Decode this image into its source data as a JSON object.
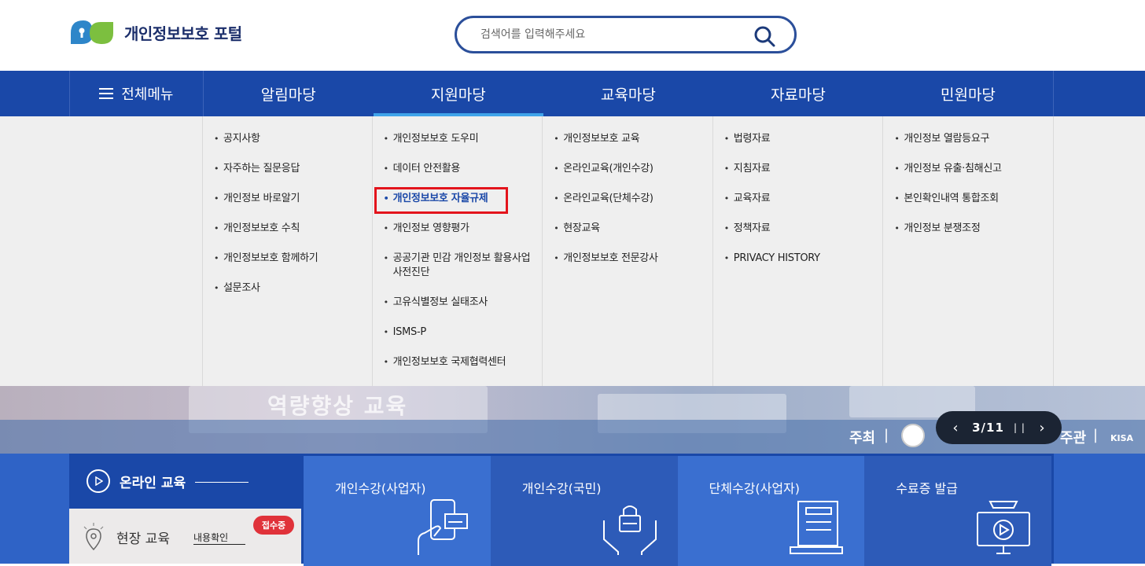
{
  "header": {
    "logo_text": "개인정보보호 포털",
    "search_placeholder": "검색어를 입력해주세요"
  },
  "nav": {
    "all_menu": "전체메뉴",
    "tabs": [
      "알림마당",
      "지원마당",
      "교육마당",
      "자료마당",
      "민원마당"
    ],
    "active_tab": "지원마당"
  },
  "mega_menu": {
    "columns": [
      [
        "공지사항",
        "자주하는 질문응답",
        "개인정보 바로알기",
        "개인정보보호 수칙",
        "개인정보보호 함께하기",
        "설문조사"
      ],
      [
        "개인정보보호 도우미",
        "데이터 안전활용",
        "개인정보보호 자율규제",
        "개인정보 영향평가",
        "공공기관 민감 개인정보 활용사업 사전진단",
        "고유식별정보 실태조사",
        "ISMS-P",
        "개인정보보호 국제협력센터"
      ],
      [
        "개인정보보호 교육",
        "온라인교육(개인수강)",
        "온라인교육(단체수강)",
        "현장교육",
        "개인정보보호 전문강사"
      ],
      [
        "법령자료",
        "지침자료",
        "교육자료",
        "정책자료",
        "PRIVACY HISTORY"
      ],
      [
        "개인정보 열람등요구",
        "개인정보 유출·침해신고",
        "본인확인내역 통합조회",
        "개인정보 분쟁조정"
      ]
    ],
    "highlighted": "개인정보보호 자율규제"
  },
  "hero": {
    "title": "역량향상 교육",
    "host": "주최",
    "organizer": "주관",
    "kisa": "KISA",
    "slider_count": "3/11"
  },
  "education": {
    "online_label": "온라인 교육",
    "field_label": "현장 교육",
    "field_check": "내용확인",
    "field_badge": "접수중",
    "cards": [
      "개인수강(사업자)",
      "개인수강(국민)",
      "단체수강(사업자)",
      "수료증 발급"
    ]
  },
  "colors": {
    "nav_blue": "#1a48a8",
    "card_blue_1": "#3a6fd0",
    "card_blue_2": "#2d5bb8",
    "active_underline": "#3fa4ea",
    "highlight_red": "#e3141c",
    "badge_red": "#e0323a"
  }
}
